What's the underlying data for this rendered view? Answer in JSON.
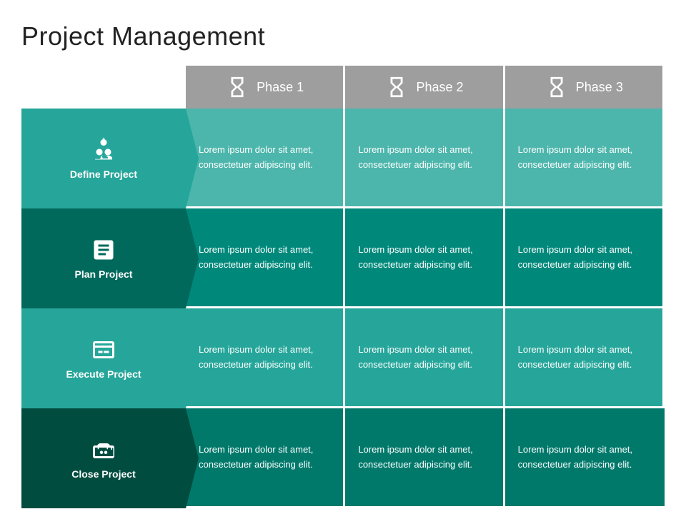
{
  "title": "Project Management",
  "phases": [
    {
      "label": "Phase 1"
    },
    {
      "label": "Phase 2"
    },
    {
      "label": "Phase 3"
    }
  ],
  "rows": [
    {
      "label": "Define Project",
      "iconName": "define-icon",
      "cells": [
        "Lorem ipsum dolor sit amet, consectetuer adipiscing elit.",
        "Lorem ipsum dolor sit amet, consectetuer adipiscing elit.",
        "Lorem ipsum dolor sit amet, consectetuer adipiscing elit."
      ]
    },
    {
      "label": "Plan Project",
      "iconName": "plan-icon",
      "cells": [
        "Lorem ipsum dolor sit amet, consectetuer adipiscing elit.",
        "Lorem ipsum dolor sit amet, consectetuer adipiscing elit.",
        "Lorem ipsum dolor sit amet, consectetuer adipiscing elit."
      ]
    },
    {
      "label": "Execute Project",
      "iconName": "execute-icon",
      "cells": [
        "Lorem ipsum dolor sit amet, consectetuer adipiscing elit.",
        "Lorem ipsum dolor sit amet, consectetuer adipiscing elit.",
        "Lorem ipsum dolor sit amet, consectetuer adipiscing elit."
      ]
    },
    {
      "label": "Close Project",
      "iconName": "close-icon",
      "cells": [
        "Lorem ipsum dolor sit amet, consectetuer adipiscing elit.",
        "Lorem ipsum dolor sit amet, consectetuer adipiscing elit.",
        "Lorem ipsum dolor sit amet, consectetuer adipiscing elit."
      ]
    }
  ]
}
